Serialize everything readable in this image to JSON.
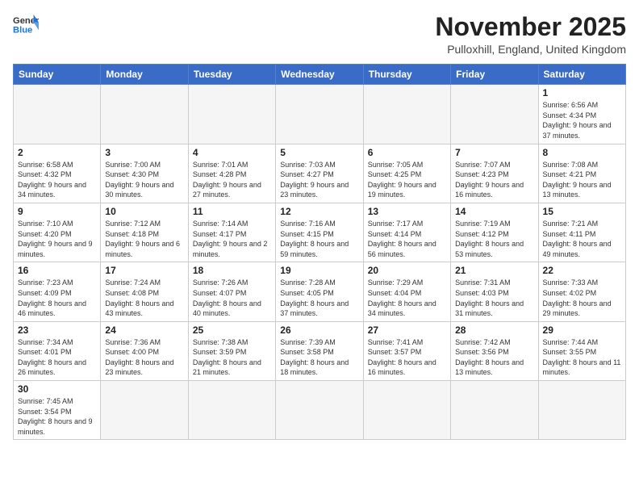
{
  "header": {
    "logo_general": "General",
    "logo_blue": "Blue",
    "title": "November 2025",
    "location": "Pulloxhill, England, United Kingdom"
  },
  "weekdays": [
    "Sunday",
    "Monday",
    "Tuesday",
    "Wednesday",
    "Thursday",
    "Friday",
    "Saturday"
  ],
  "weeks": [
    [
      {
        "day": "",
        "info": ""
      },
      {
        "day": "",
        "info": ""
      },
      {
        "day": "",
        "info": ""
      },
      {
        "day": "",
        "info": ""
      },
      {
        "day": "",
        "info": ""
      },
      {
        "day": "",
        "info": ""
      },
      {
        "day": "1",
        "info": "Sunrise: 6:56 AM\nSunset: 4:34 PM\nDaylight: 9 hours and 37 minutes."
      }
    ],
    [
      {
        "day": "2",
        "info": "Sunrise: 6:58 AM\nSunset: 4:32 PM\nDaylight: 9 hours and 34 minutes."
      },
      {
        "day": "3",
        "info": "Sunrise: 7:00 AM\nSunset: 4:30 PM\nDaylight: 9 hours and 30 minutes."
      },
      {
        "day": "4",
        "info": "Sunrise: 7:01 AM\nSunset: 4:28 PM\nDaylight: 9 hours and 27 minutes."
      },
      {
        "day": "5",
        "info": "Sunrise: 7:03 AM\nSunset: 4:27 PM\nDaylight: 9 hours and 23 minutes."
      },
      {
        "day": "6",
        "info": "Sunrise: 7:05 AM\nSunset: 4:25 PM\nDaylight: 9 hours and 19 minutes."
      },
      {
        "day": "7",
        "info": "Sunrise: 7:07 AM\nSunset: 4:23 PM\nDaylight: 9 hours and 16 minutes."
      },
      {
        "day": "8",
        "info": "Sunrise: 7:08 AM\nSunset: 4:21 PM\nDaylight: 9 hours and 13 minutes."
      }
    ],
    [
      {
        "day": "9",
        "info": "Sunrise: 7:10 AM\nSunset: 4:20 PM\nDaylight: 9 hours and 9 minutes."
      },
      {
        "day": "10",
        "info": "Sunrise: 7:12 AM\nSunset: 4:18 PM\nDaylight: 9 hours and 6 minutes."
      },
      {
        "day": "11",
        "info": "Sunrise: 7:14 AM\nSunset: 4:17 PM\nDaylight: 9 hours and 2 minutes."
      },
      {
        "day": "12",
        "info": "Sunrise: 7:16 AM\nSunset: 4:15 PM\nDaylight: 8 hours and 59 minutes."
      },
      {
        "day": "13",
        "info": "Sunrise: 7:17 AM\nSunset: 4:14 PM\nDaylight: 8 hours and 56 minutes."
      },
      {
        "day": "14",
        "info": "Sunrise: 7:19 AM\nSunset: 4:12 PM\nDaylight: 8 hours and 53 minutes."
      },
      {
        "day": "15",
        "info": "Sunrise: 7:21 AM\nSunset: 4:11 PM\nDaylight: 8 hours and 49 minutes."
      }
    ],
    [
      {
        "day": "16",
        "info": "Sunrise: 7:23 AM\nSunset: 4:09 PM\nDaylight: 8 hours and 46 minutes."
      },
      {
        "day": "17",
        "info": "Sunrise: 7:24 AM\nSunset: 4:08 PM\nDaylight: 8 hours and 43 minutes."
      },
      {
        "day": "18",
        "info": "Sunrise: 7:26 AM\nSunset: 4:07 PM\nDaylight: 8 hours and 40 minutes."
      },
      {
        "day": "19",
        "info": "Sunrise: 7:28 AM\nSunset: 4:05 PM\nDaylight: 8 hours and 37 minutes."
      },
      {
        "day": "20",
        "info": "Sunrise: 7:29 AM\nSunset: 4:04 PM\nDaylight: 8 hours and 34 minutes."
      },
      {
        "day": "21",
        "info": "Sunrise: 7:31 AM\nSunset: 4:03 PM\nDaylight: 8 hours and 31 minutes."
      },
      {
        "day": "22",
        "info": "Sunrise: 7:33 AM\nSunset: 4:02 PM\nDaylight: 8 hours and 29 minutes."
      }
    ],
    [
      {
        "day": "23",
        "info": "Sunrise: 7:34 AM\nSunset: 4:01 PM\nDaylight: 8 hours and 26 minutes."
      },
      {
        "day": "24",
        "info": "Sunrise: 7:36 AM\nSunset: 4:00 PM\nDaylight: 8 hours and 23 minutes."
      },
      {
        "day": "25",
        "info": "Sunrise: 7:38 AM\nSunset: 3:59 PM\nDaylight: 8 hours and 21 minutes."
      },
      {
        "day": "26",
        "info": "Sunrise: 7:39 AM\nSunset: 3:58 PM\nDaylight: 8 hours and 18 minutes."
      },
      {
        "day": "27",
        "info": "Sunrise: 7:41 AM\nSunset: 3:57 PM\nDaylight: 8 hours and 16 minutes."
      },
      {
        "day": "28",
        "info": "Sunrise: 7:42 AM\nSunset: 3:56 PM\nDaylight: 8 hours and 13 minutes."
      },
      {
        "day": "29",
        "info": "Sunrise: 7:44 AM\nSunset: 3:55 PM\nDaylight: 8 hours and 11 minutes."
      }
    ],
    [
      {
        "day": "30",
        "info": "Sunrise: 7:45 AM\nSunset: 3:54 PM\nDaylight: 8 hours and 9 minutes."
      },
      {
        "day": "",
        "info": ""
      },
      {
        "day": "",
        "info": ""
      },
      {
        "day": "",
        "info": ""
      },
      {
        "day": "",
        "info": ""
      },
      {
        "day": "",
        "info": ""
      },
      {
        "day": "",
        "info": ""
      }
    ]
  ]
}
